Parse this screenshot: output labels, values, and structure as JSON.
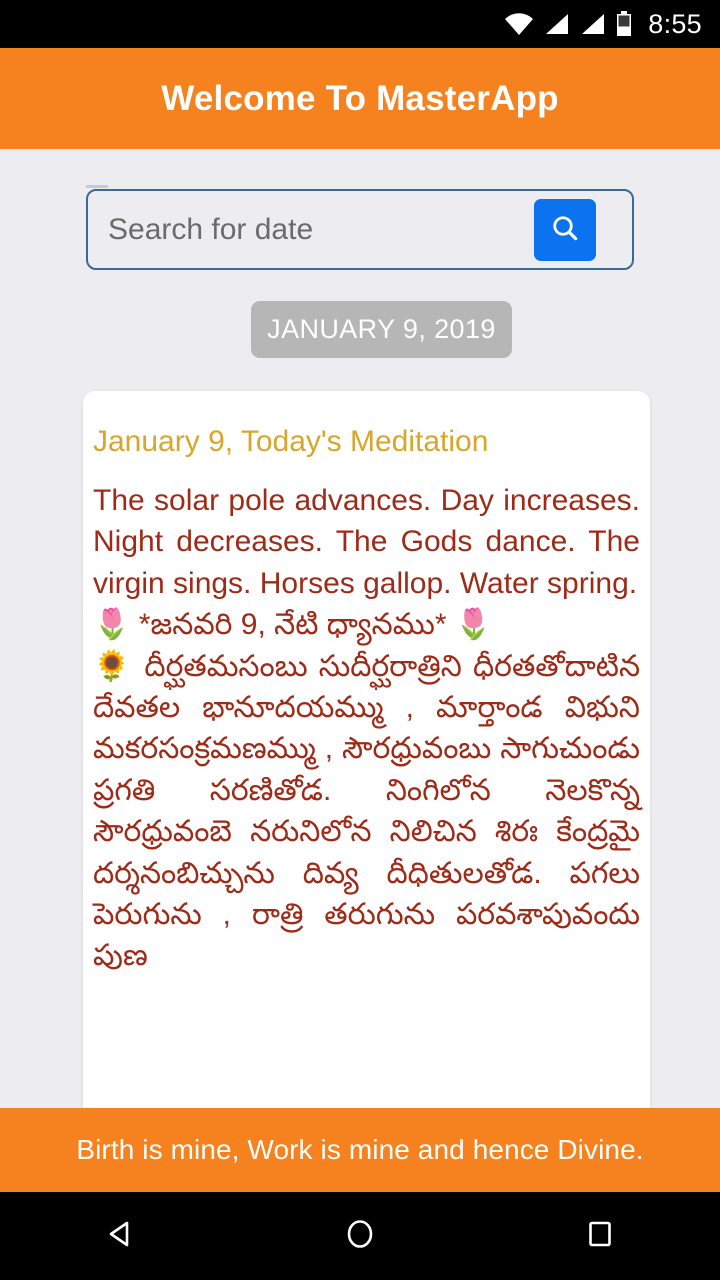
{
  "status_bar": {
    "time": "8:55",
    "icons": [
      "wifi-icon",
      "signal-icon",
      "signal-icon",
      "battery-icon"
    ]
  },
  "app_bar": {
    "title": "Welcome To MasterApp"
  },
  "search": {
    "placeholder": "Search for date",
    "value": "",
    "button_icon": "search-icon",
    "button_color": "#0b73f0",
    "border_color": "#3a6a96"
  },
  "date_chip": {
    "label": "JANUARY 9, 2019",
    "background": "#b6b6b6"
  },
  "card": {
    "title": "January 9, Today's Meditation",
    "title_color": "#d7a62b",
    "body_color": "#9e2a18",
    "paragraphs": [
      "The solar pole advances. Day increases. Night decreases. The Gods dance. The virgin sings. Horses gallop. Water spring.",
      "🌷 *జనవరి 9, నేటి ధ్యానము* 🌷",
      "🌻 దీర్ఘతమసంబు సుదీర్ఘరాత్రిని ధీరతతోదాటిన దేవతల భానూదయమ్ము , మార్తాండ విభుని మకరసంక్రమణమ్ము , సౌరధ్రువంబు సాగుచుండు ప్రగతి సరణితోడ. నింగిలోన నెలకొన్న సౌరధ్రువంబె నరునిలోన నిలిచిన శిరః కేంద్రమై దర్శనంబిచ్చును దివ్య దీధితులతోడ. పగలు పెరుగును , రాత్రి తరుగును పరవశాపువందు పుణ"
    ]
  },
  "footer": {
    "text": "Birth is mine, Work is mine and hence Divine.",
    "background": "#f5821f"
  },
  "nav_bar": {
    "back_icon": "back-triangle-icon",
    "home_icon": "home-circle-icon",
    "recents_icon": "recents-square-icon"
  },
  "theme": {
    "accent_orange": "#f5821f",
    "page_background": "#ededf1",
    "card_background": "#ffffff"
  }
}
